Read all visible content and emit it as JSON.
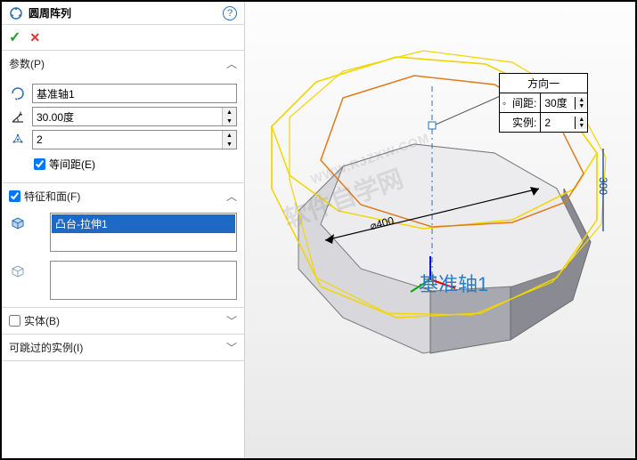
{
  "header": {
    "title": "圆周阵列"
  },
  "actions": {
    "ok": "✓",
    "cancel": "✕"
  },
  "parameters": {
    "title": "参数(P)",
    "axis": "基准轴1",
    "angle": "30.00度",
    "instances": "2",
    "equal_spacing_label": "等间距(E)",
    "equal_spacing_checked": true
  },
  "features": {
    "title": "特征和面(F)",
    "checked": true,
    "items": [
      "凸台-拉伸1"
    ]
  },
  "bodies": {
    "title": "实体(B)",
    "checked": false
  },
  "skippable": {
    "title": "可跳过的实例(I)"
  },
  "callout": {
    "title": "方向一",
    "spacing_label": "间距:",
    "spacing_value": "30度",
    "instances_label": "实例:",
    "instances_value": "2"
  },
  "viewport": {
    "axis_label": "基准轴1",
    "diameter_label": "⌀400",
    "side_dim": "300"
  },
  "watermark": {
    "line1": "软件自学网",
    "line2": "WWW.RJZXW.COM"
  }
}
